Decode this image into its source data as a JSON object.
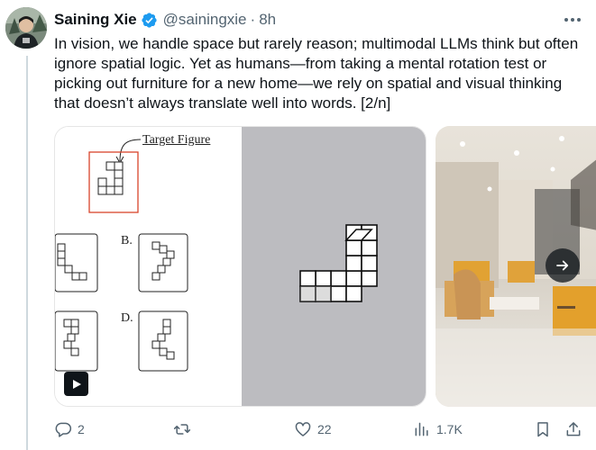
{
  "author": {
    "name": "Saining Xie",
    "handle": "@sainingxie",
    "separator": "·",
    "time": "8h"
  },
  "tweet": {
    "text": "In vision, we handle space but rarely reason; multimodal LLMs think but often ignore spatial logic. Yet as humans—from taking a mental rotation test or picking out furniture for a new home—we rely on spatial and visual thinking that doesn’t always translate well into words. [2/n]"
  },
  "media": {
    "target_label": "Target Figure",
    "option_b": "B.",
    "option_d": "D."
  },
  "actions": {
    "replies": "2",
    "reposts": "",
    "likes": "22",
    "views": "1.7K"
  },
  "colors": {
    "verified": "#1d9bf0",
    "icon": "#536471",
    "target_box": "#d9442b",
    "thread_line": "#cfd9de"
  }
}
